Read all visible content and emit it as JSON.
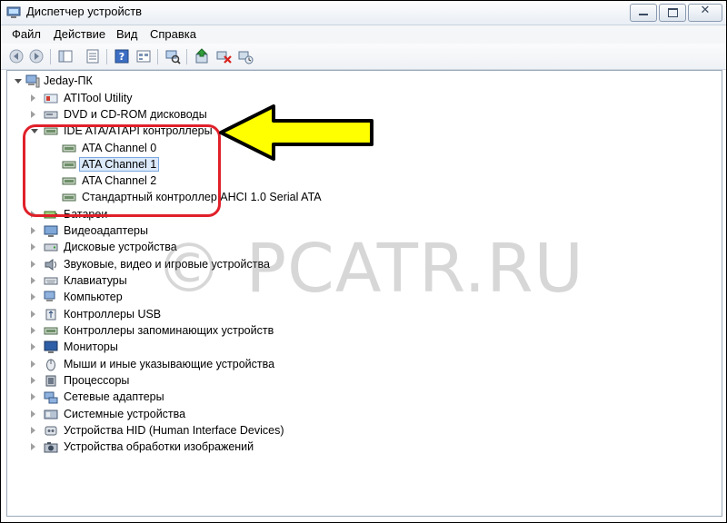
{
  "window": {
    "title": "Диспетчер устройств",
    "close_glyph": "✕"
  },
  "menu": {
    "items": [
      "Файл",
      "Действие",
      "Вид",
      "Справка"
    ]
  },
  "toolbar": {
    "buttons": [
      "back-icon",
      "forward-icon",
      "show-hide-console-tree-icon",
      "properties-icon",
      "help-icon",
      "view-icon",
      "scan-hardware-icon",
      "update-driver-icon",
      "disable-device-icon",
      "uninstall-device-icon"
    ]
  },
  "tree": {
    "root": "Jeday-ПК",
    "nodes": [
      {
        "label": "ATITool Utility",
        "state": "collapsed"
      },
      {
        "label": "DVD и CD-ROM дисководы",
        "state": "collapsed"
      },
      {
        "label": "IDE ATA/ATAPI контроллеры",
        "state": "expanded",
        "children": [
          "ATA Channel 0",
          "ATA Channel 1",
          "ATA Channel 2",
          "Стандартный контроллер AHCI 1.0 Serial ATA"
        ],
        "selected_child": "ATA Channel 1"
      },
      {
        "label": "Батареи",
        "state": "collapsed"
      },
      {
        "label": "Видеоадаптеры",
        "state": "collapsed"
      },
      {
        "label": "Дисковые устройства",
        "state": "collapsed"
      },
      {
        "label": "Звуковые, видео и игровые устройства",
        "state": "collapsed"
      },
      {
        "label": "Клавиатуры",
        "state": "collapsed"
      },
      {
        "label": "Компьютер",
        "state": "collapsed"
      },
      {
        "label": "Контроллеры USB",
        "state": "collapsed"
      },
      {
        "label": "Контроллеры запоминающих устройств",
        "state": "collapsed"
      },
      {
        "label": "Мониторы",
        "state": "collapsed"
      },
      {
        "label": "Мыши и иные указывающие устройства",
        "state": "collapsed"
      },
      {
        "label": "Процессоры",
        "state": "collapsed"
      },
      {
        "label": "Сетевые адаптеры",
        "state": "collapsed"
      },
      {
        "label": "Системные устройства",
        "state": "collapsed"
      },
      {
        "label": "Устройства HID (Human Interface Devices)",
        "state": "collapsed"
      },
      {
        "label": "Устройства обработки изображений",
        "state": "collapsed"
      }
    ]
  },
  "overlay": {
    "watermark": "© PCATR.RU",
    "arrow_color": "#ffff00",
    "ring_color": "#e0202a"
  }
}
